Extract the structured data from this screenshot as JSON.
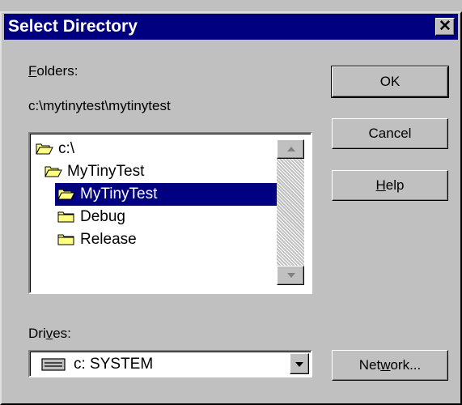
{
  "window": {
    "title": "Select Directory",
    "close_glyph": "✕"
  },
  "folders": {
    "label_underline": "F",
    "label_rest": "olders:",
    "current_path": "c:\\mytinytest\\mytinytest",
    "items": [
      {
        "label": "c:\\",
        "icon": "open-folder-icon",
        "selected": false
      },
      {
        "label": "MyTinyTest",
        "icon": "open-folder-icon",
        "selected": false
      },
      {
        "label": "MyTinyTest",
        "icon": "open-folder-icon",
        "selected": true
      },
      {
        "label": "Debug",
        "icon": "folder-icon",
        "selected": false
      },
      {
        "label": "Release",
        "icon": "folder-icon",
        "selected": false
      }
    ]
  },
  "buttons": {
    "ok": "OK",
    "cancel": "Cancel",
    "help_underline": "H",
    "help_rest": "elp",
    "network_pre": "Net",
    "network_underline": "w",
    "network_post": "ork..."
  },
  "drives": {
    "label_pre": "Dri",
    "label_underline": "v",
    "label_post": "es:",
    "selected": "c: SYSTEM",
    "icon": "drive-icon"
  },
  "colors": {
    "title_bar": "#000080",
    "face": "#c0c0c0",
    "selection": "#000080"
  }
}
